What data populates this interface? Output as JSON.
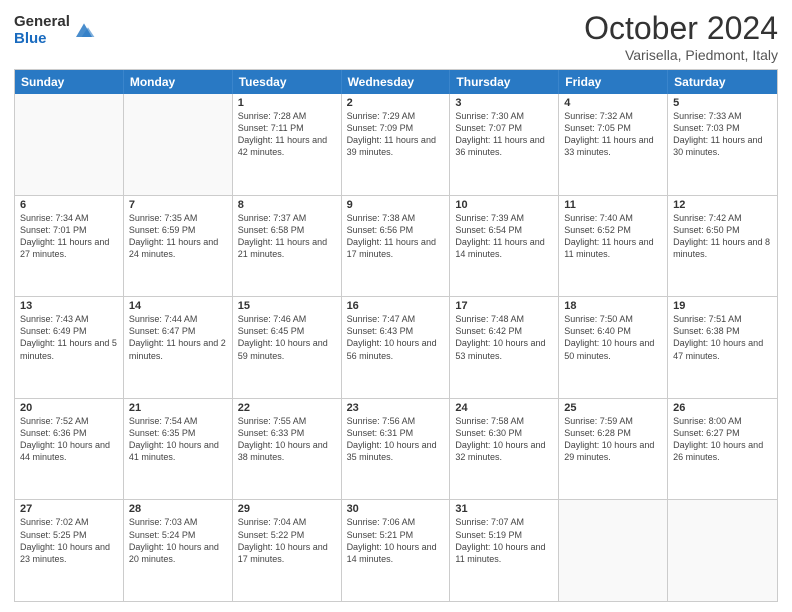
{
  "header": {
    "logo_line1": "General",
    "logo_line2": "Blue",
    "month": "October 2024",
    "location": "Varisella, Piedmont, Italy"
  },
  "days_of_week": [
    "Sunday",
    "Monday",
    "Tuesday",
    "Wednesday",
    "Thursday",
    "Friday",
    "Saturday"
  ],
  "weeks": [
    [
      {
        "day": "",
        "sunrise": "",
        "sunset": "",
        "daylight": "",
        "empty": true
      },
      {
        "day": "",
        "sunrise": "",
        "sunset": "",
        "daylight": "",
        "empty": true
      },
      {
        "day": "1",
        "sunrise": "Sunrise: 7:28 AM",
        "sunset": "Sunset: 7:11 PM",
        "daylight": "Daylight: 11 hours and 42 minutes.",
        "empty": false
      },
      {
        "day": "2",
        "sunrise": "Sunrise: 7:29 AM",
        "sunset": "Sunset: 7:09 PM",
        "daylight": "Daylight: 11 hours and 39 minutes.",
        "empty": false
      },
      {
        "day": "3",
        "sunrise": "Sunrise: 7:30 AM",
        "sunset": "Sunset: 7:07 PM",
        "daylight": "Daylight: 11 hours and 36 minutes.",
        "empty": false
      },
      {
        "day": "4",
        "sunrise": "Sunrise: 7:32 AM",
        "sunset": "Sunset: 7:05 PM",
        "daylight": "Daylight: 11 hours and 33 minutes.",
        "empty": false
      },
      {
        "day": "5",
        "sunrise": "Sunrise: 7:33 AM",
        "sunset": "Sunset: 7:03 PM",
        "daylight": "Daylight: 11 hours and 30 minutes.",
        "empty": false
      }
    ],
    [
      {
        "day": "6",
        "sunrise": "Sunrise: 7:34 AM",
        "sunset": "Sunset: 7:01 PM",
        "daylight": "Daylight: 11 hours and 27 minutes.",
        "empty": false
      },
      {
        "day": "7",
        "sunrise": "Sunrise: 7:35 AM",
        "sunset": "Sunset: 6:59 PM",
        "daylight": "Daylight: 11 hours and 24 minutes.",
        "empty": false
      },
      {
        "day": "8",
        "sunrise": "Sunrise: 7:37 AM",
        "sunset": "Sunset: 6:58 PM",
        "daylight": "Daylight: 11 hours and 21 minutes.",
        "empty": false
      },
      {
        "day": "9",
        "sunrise": "Sunrise: 7:38 AM",
        "sunset": "Sunset: 6:56 PM",
        "daylight": "Daylight: 11 hours and 17 minutes.",
        "empty": false
      },
      {
        "day": "10",
        "sunrise": "Sunrise: 7:39 AM",
        "sunset": "Sunset: 6:54 PM",
        "daylight": "Daylight: 11 hours and 14 minutes.",
        "empty": false
      },
      {
        "day": "11",
        "sunrise": "Sunrise: 7:40 AM",
        "sunset": "Sunset: 6:52 PM",
        "daylight": "Daylight: 11 hours and 11 minutes.",
        "empty": false
      },
      {
        "day": "12",
        "sunrise": "Sunrise: 7:42 AM",
        "sunset": "Sunset: 6:50 PM",
        "daylight": "Daylight: 11 hours and 8 minutes.",
        "empty": false
      }
    ],
    [
      {
        "day": "13",
        "sunrise": "Sunrise: 7:43 AM",
        "sunset": "Sunset: 6:49 PM",
        "daylight": "Daylight: 11 hours and 5 minutes.",
        "empty": false
      },
      {
        "day": "14",
        "sunrise": "Sunrise: 7:44 AM",
        "sunset": "Sunset: 6:47 PM",
        "daylight": "Daylight: 11 hours and 2 minutes.",
        "empty": false
      },
      {
        "day": "15",
        "sunrise": "Sunrise: 7:46 AM",
        "sunset": "Sunset: 6:45 PM",
        "daylight": "Daylight: 10 hours and 59 minutes.",
        "empty": false
      },
      {
        "day": "16",
        "sunrise": "Sunrise: 7:47 AM",
        "sunset": "Sunset: 6:43 PM",
        "daylight": "Daylight: 10 hours and 56 minutes.",
        "empty": false
      },
      {
        "day": "17",
        "sunrise": "Sunrise: 7:48 AM",
        "sunset": "Sunset: 6:42 PM",
        "daylight": "Daylight: 10 hours and 53 minutes.",
        "empty": false
      },
      {
        "day": "18",
        "sunrise": "Sunrise: 7:50 AM",
        "sunset": "Sunset: 6:40 PM",
        "daylight": "Daylight: 10 hours and 50 minutes.",
        "empty": false
      },
      {
        "day": "19",
        "sunrise": "Sunrise: 7:51 AM",
        "sunset": "Sunset: 6:38 PM",
        "daylight": "Daylight: 10 hours and 47 minutes.",
        "empty": false
      }
    ],
    [
      {
        "day": "20",
        "sunrise": "Sunrise: 7:52 AM",
        "sunset": "Sunset: 6:36 PM",
        "daylight": "Daylight: 10 hours and 44 minutes.",
        "empty": false
      },
      {
        "day": "21",
        "sunrise": "Sunrise: 7:54 AM",
        "sunset": "Sunset: 6:35 PM",
        "daylight": "Daylight: 10 hours and 41 minutes.",
        "empty": false
      },
      {
        "day": "22",
        "sunrise": "Sunrise: 7:55 AM",
        "sunset": "Sunset: 6:33 PM",
        "daylight": "Daylight: 10 hours and 38 minutes.",
        "empty": false
      },
      {
        "day": "23",
        "sunrise": "Sunrise: 7:56 AM",
        "sunset": "Sunset: 6:31 PM",
        "daylight": "Daylight: 10 hours and 35 minutes.",
        "empty": false
      },
      {
        "day": "24",
        "sunrise": "Sunrise: 7:58 AM",
        "sunset": "Sunset: 6:30 PM",
        "daylight": "Daylight: 10 hours and 32 minutes.",
        "empty": false
      },
      {
        "day": "25",
        "sunrise": "Sunrise: 7:59 AM",
        "sunset": "Sunset: 6:28 PM",
        "daylight": "Daylight: 10 hours and 29 minutes.",
        "empty": false
      },
      {
        "day": "26",
        "sunrise": "Sunrise: 8:00 AM",
        "sunset": "Sunset: 6:27 PM",
        "daylight": "Daylight: 10 hours and 26 minutes.",
        "empty": false
      }
    ],
    [
      {
        "day": "27",
        "sunrise": "Sunrise: 7:02 AM",
        "sunset": "Sunset: 5:25 PM",
        "daylight": "Daylight: 10 hours and 23 minutes.",
        "empty": false
      },
      {
        "day": "28",
        "sunrise": "Sunrise: 7:03 AM",
        "sunset": "Sunset: 5:24 PM",
        "daylight": "Daylight: 10 hours and 20 minutes.",
        "empty": false
      },
      {
        "day": "29",
        "sunrise": "Sunrise: 7:04 AM",
        "sunset": "Sunset: 5:22 PM",
        "daylight": "Daylight: 10 hours and 17 minutes.",
        "empty": false
      },
      {
        "day": "30",
        "sunrise": "Sunrise: 7:06 AM",
        "sunset": "Sunset: 5:21 PM",
        "daylight": "Daylight: 10 hours and 14 minutes.",
        "empty": false
      },
      {
        "day": "31",
        "sunrise": "Sunrise: 7:07 AM",
        "sunset": "Sunset: 5:19 PM",
        "daylight": "Daylight: 10 hours and 11 minutes.",
        "empty": false
      },
      {
        "day": "",
        "sunrise": "",
        "sunset": "",
        "daylight": "",
        "empty": true
      },
      {
        "day": "",
        "sunrise": "",
        "sunset": "",
        "daylight": "",
        "empty": true
      }
    ]
  ]
}
